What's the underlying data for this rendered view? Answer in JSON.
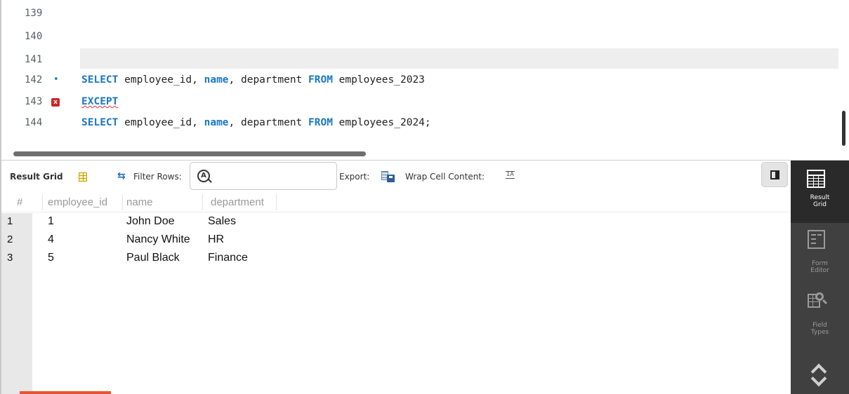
{
  "editor": {
    "lines": [
      {
        "num": "139"
      },
      {
        "num": "140"
      },
      {
        "num": "141"
      },
      {
        "num": "142",
        "marker": "•",
        "kw1": "SELECT",
        "t1": " employee_id, ",
        "kw2": "name",
        "t2": ", department ",
        "kw3": "FROM",
        "t3": " employees_2023"
      },
      {
        "num": "143",
        "marker": "x",
        "kw1": "EXCEPT"
      },
      {
        "num": "144",
        "kw1": "SELECT",
        "t1": " employee_id, ",
        "kw2": "name",
        "t2": ", department ",
        "kw3": "FROM",
        "t3": " employees_2024;"
      }
    ]
  },
  "toolbar": {
    "result_grid_label": "Result Grid",
    "filter_rows_label": "Filter Rows:",
    "filter_placeholder": "",
    "export_label": "Export:",
    "wrap_label": "Wrap Cell Content:",
    "wrap_icon_text": "IA"
  },
  "grid": {
    "columns": [
      "#",
      "employee_id",
      "name",
      "department"
    ],
    "rows": [
      {
        "num": "1",
        "employee_id": "1",
        "name": "John Doe",
        "department": "Sales"
      },
      {
        "num": "2",
        "employee_id": "4",
        "name": "Nancy White",
        "department": "HR"
      },
      {
        "num": "3",
        "employee_id": "5",
        "name": "Paul Black",
        "department": "Finance"
      }
    ]
  },
  "sidepanel": {
    "result_grid": [
      "Result",
      "Grid"
    ],
    "form_editor": [
      "Form",
      "Editor"
    ],
    "field_types": [
      "Field",
      "Types"
    ]
  },
  "colors": {
    "keyword": "#1a78c2",
    "side_panel_bg": "#404040",
    "row_gutter_bg": "#e8e8e8"
  },
  "icons": [
    "grid-view-icon",
    "refresh-icon",
    "search-filter-icon",
    "export-icon",
    "wrap-cell-icon",
    "panel-toggle-icon",
    "result-grid-icon",
    "form-editor-icon",
    "field-types-icon",
    "scroll-chevrons-icon"
  ]
}
